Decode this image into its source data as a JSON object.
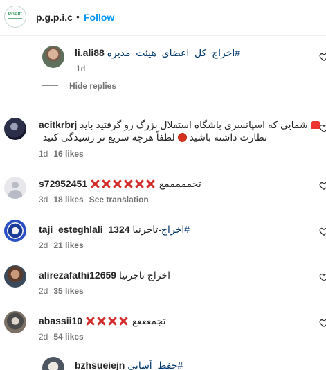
{
  "header": {
    "username": "p.g.p.i.c",
    "separator": "•",
    "follow_label": "Follow",
    "logo_text": "PGPIC"
  },
  "reply_thread": {
    "hide_replies_label": "Hide replies",
    "reply": {
      "username": "li.ali88",
      "hashtag": "#اخراج_کل_اعضای_هیئت_مدیره",
      "time": "1d"
    }
  },
  "comments": [
    {
      "username": "acitkrbrj",
      "text_line1": "شمایی که اسپانسری باشگاه استقلال بزرگ رو گرفتید باید",
      "text_line2": "نظارت داشته باشید",
      "text_line2_after": "لطفاً هرچه سریع تر رسیدگی کنید",
      "time": "1d",
      "likes": "16 likes"
    },
    {
      "username": "s72952451",
      "text": "تجمممممع",
      "time": "3d",
      "likes": "18 likes",
      "see_translation": "See translation"
    },
    {
      "username": "taji_esteghlali_1324",
      "hashtag": "#اخراج",
      "text": "-تاجرنیا",
      "time": "2d",
      "likes": "21 likes"
    },
    {
      "username": "alirezafathi12659",
      "text": "اخراج تاجرنیا",
      "time": "2d",
      "likes": "35 likes"
    },
    {
      "username": "abassii10",
      "text": "تجمعععع",
      "time": "2d",
      "likes": "54 likes"
    },
    {
      "username": "bzhsueiejn",
      "hashtag": "#حفظ_آسانی"
    }
  ],
  "icons": {
    "heart": "heart-icon",
    "siren": "siren-emoji",
    "angry": "angry-face-emoji",
    "cross": "cross-mark-emoji"
  },
  "colors": {
    "link_blue": "#0095f6",
    "hashtag_blue": "#00376b",
    "meta_gray": "#737373",
    "cross_red": "#d42b2b"
  }
}
